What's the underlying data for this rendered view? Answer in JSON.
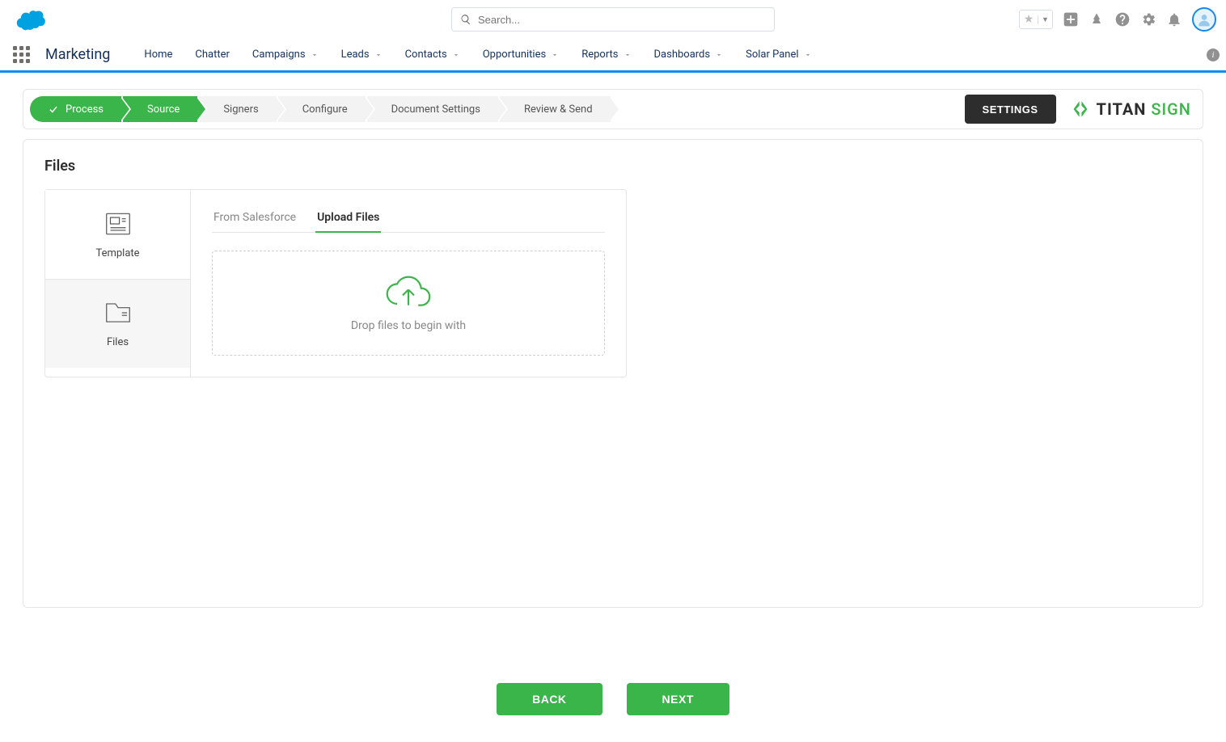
{
  "search": {
    "placeholder": "Search..."
  },
  "nav": {
    "appName": "Marketing",
    "items": [
      {
        "label": "Home",
        "hasMenu": false
      },
      {
        "label": "Chatter",
        "hasMenu": false
      },
      {
        "label": "Campaigns",
        "hasMenu": true
      },
      {
        "label": "Leads",
        "hasMenu": true
      },
      {
        "label": "Contacts",
        "hasMenu": true
      },
      {
        "label": "Opportunities",
        "hasMenu": true
      },
      {
        "label": "Reports",
        "hasMenu": true
      },
      {
        "label": "Dashboards",
        "hasMenu": true
      },
      {
        "label": "Solar Panel",
        "hasMenu": true
      }
    ]
  },
  "wizard": {
    "steps": [
      {
        "label": "Process",
        "state": "done"
      },
      {
        "label": "Source",
        "state": "active"
      },
      {
        "label": "Signers",
        "state": "idle"
      },
      {
        "label": "Configure",
        "state": "idle"
      },
      {
        "label": "Document Settings",
        "state": "idle"
      },
      {
        "label": "Review & Send",
        "state": "idle"
      }
    ],
    "settingsLabel": "SETTINGS",
    "logo": {
      "part1": "TITAN",
      "part2": "SIGN"
    }
  },
  "files": {
    "sectionTitle": "Files",
    "side": {
      "template": "Template",
      "files": "Files"
    },
    "tabs": {
      "fromSalesforce": "From Salesforce",
      "uploadFiles": "Upload Files"
    },
    "dropText": "Drop files to begin with"
  },
  "footer": {
    "back": "BACK",
    "next": "NEXT"
  }
}
